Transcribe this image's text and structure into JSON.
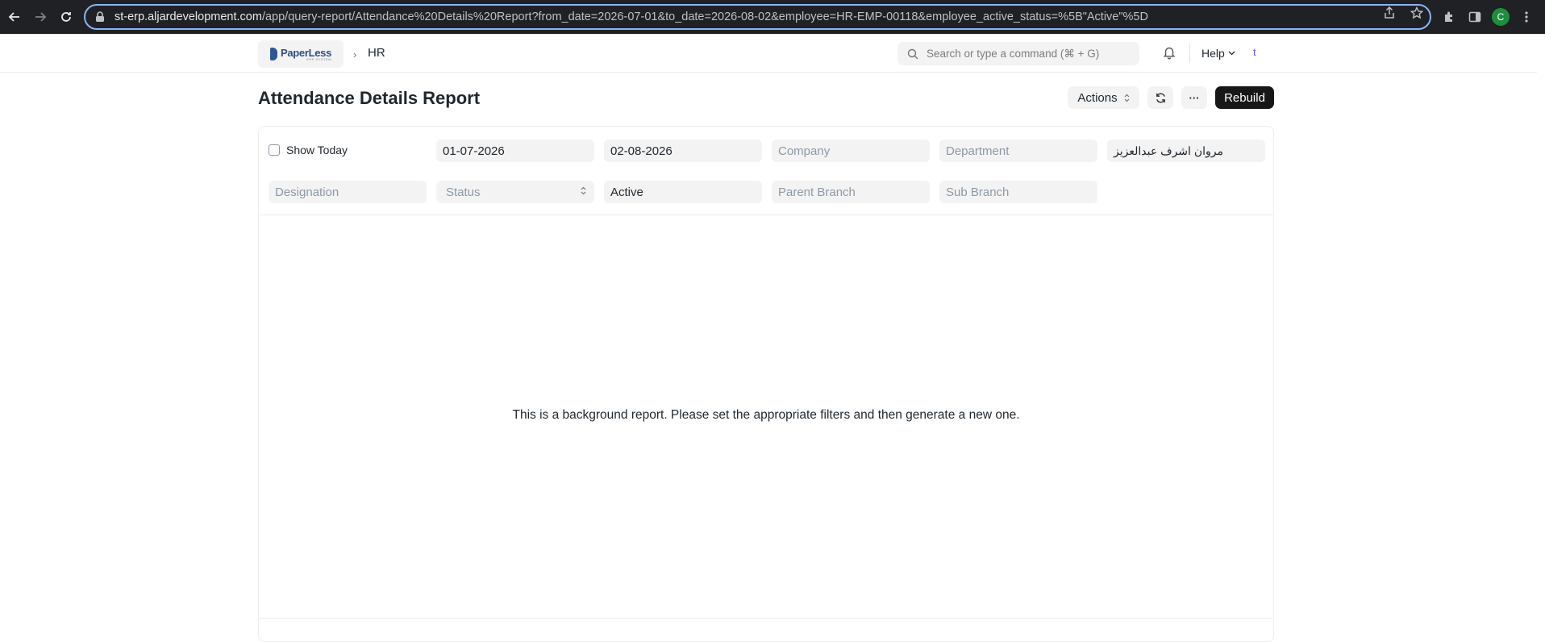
{
  "browser": {
    "url_host": "st-erp.aljardevelopment.com",
    "url_path": "/app/query-report/Attendance%20Details%20Report?from_date=2026-07-01&to_date=2026-08-02&employee=HR-EMP-00118&employee_active_status=%5B\"Active\"%5D",
    "profile_initial": "C"
  },
  "navbar": {
    "logo_text": "PaperLess",
    "logo_sub": "ERP SYSTEM",
    "breadcrumb": "HR",
    "search_placeholder": "Search or type a command (⌘ + G)",
    "help_label": "Help",
    "avatar_initial": "t"
  },
  "page": {
    "title": "Attendance Details Report",
    "actions_label": "Actions",
    "more_label": "···",
    "rebuild_label": "Rebuild"
  },
  "filters": {
    "show_today_label": "Show Today",
    "from_date": "01-07-2026",
    "to_date": "02-08-2026",
    "company_placeholder": "Company",
    "department_placeholder": "Department",
    "employee": "مروان اشرف عبدالعزيز",
    "designation_placeholder": "Designation",
    "status_placeholder": "Status",
    "active_status": "Active",
    "parent_branch_placeholder": "Parent Branch",
    "sub_branch_placeholder": "Sub Branch"
  },
  "report": {
    "message": "This is a background report. Please set the appropriate filters and then generate a new one."
  },
  "colors": {
    "accent": "#8ab4f8",
    "primary_button": "#171717"
  }
}
